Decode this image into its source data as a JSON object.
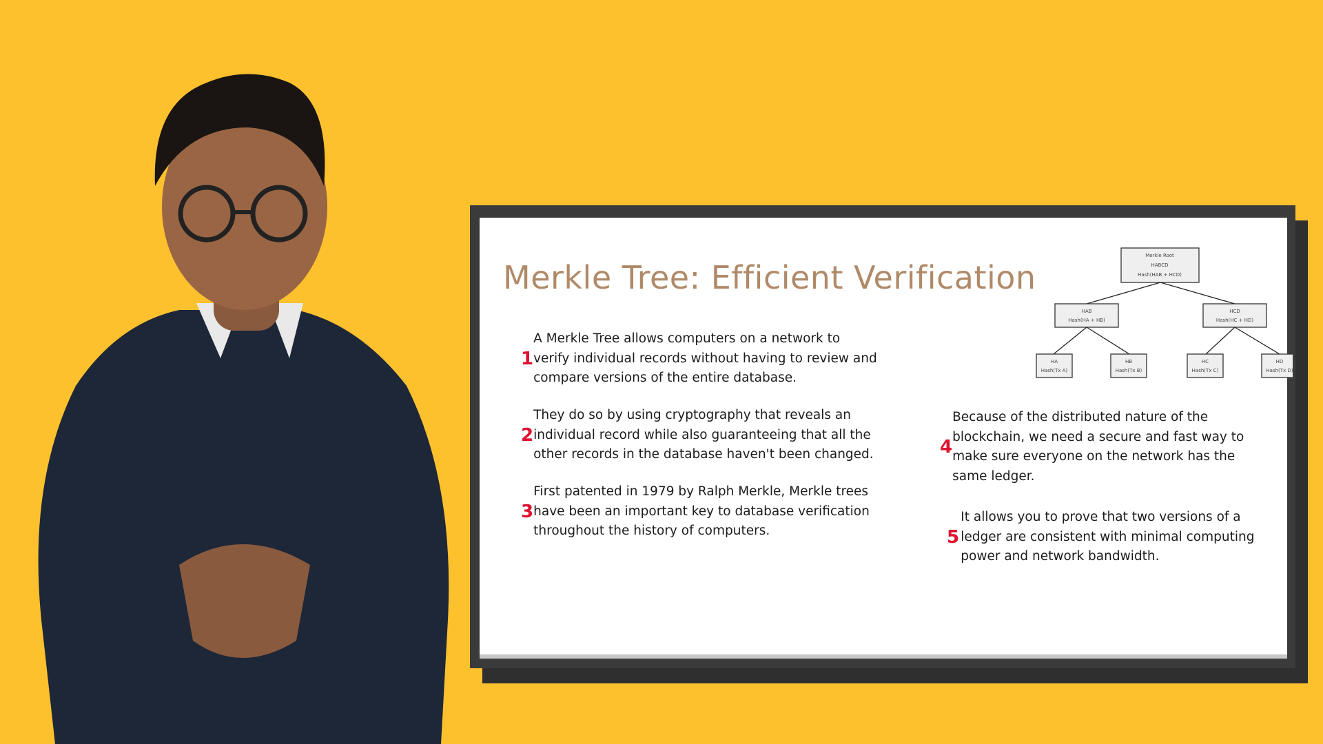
{
  "slide": {
    "title": "Merkle Tree: Efficient Verification",
    "points": [
      {
        "number": "1",
        "text": "A Merkle Tree allows computers on a network to verify individual records without having to review and compare versions of the entire database."
      },
      {
        "number": "2",
        "text": "They do so by using cryptography that reveals an individual record while also guaranteeing that all the other records in the database haven't been changed."
      },
      {
        "number": "3",
        "text": "First patented in 1979 by Ralph Merkle, Merkle trees have been an important key to database verification throughout the history of computers."
      },
      {
        "number": "4",
        "text": "Because of the distributed nature of the blockchain, we need a secure and fast way to make sure everyone on the network has the same ledger."
      },
      {
        "number": "5",
        "text": "It allows you to prove that two versions of a ledger are consistent with minimal computing power and network bandwidth."
      }
    ],
    "tree": {
      "root": {
        "line1": "Merkle Root",
        "line2": "HABCD",
        "line3": "Hash(HAB + HCD)"
      },
      "mid": [
        {
          "line1": "HAB",
          "line2": "Hash(HA + HB)"
        },
        {
          "line1": "HCD",
          "line2": "Hash(HC + HD)"
        }
      ],
      "leaves": [
        {
          "line1": "HA",
          "line2": "Hash(Tx A)"
        },
        {
          "line1": "HB",
          "line2": "Hash(Tx B)"
        },
        {
          "line1": "HC",
          "line2": "Hash(Tx C)"
        },
        {
          "line1": "HD",
          "line2": "Hash(Tx D)"
        }
      ]
    }
  },
  "colors": {
    "background": "#fdc12e",
    "title": "#b08a68",
    "number": "#e0102f",
    "frame": "#3b3b3b"
  }
}
